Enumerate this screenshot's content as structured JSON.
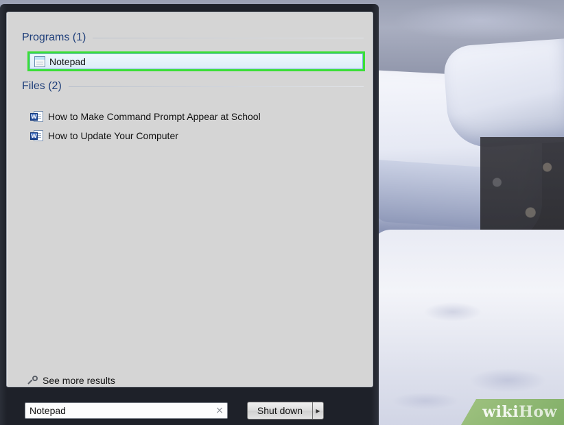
{
  "results": {
    "programs_header": "Programs (1)",
    "programs": [
      {
        "label": "Notepad",
        "icon": "notepad-icon"
      }
    ],
    "files_header": "Files (2)",
    "files": [
      {
        "label": "How to Make Command Prompt Appear at School",
        "icon": "word-document-icon"
      },
      {
        "label": "How to Update Your Computer",
        "icon": "word-document-icon"
      }
    ],
    "see_more": "See more results",
    "selection_outline_color": "#3adf36"
  },
  "search": {
    "value": "Notepad",
    "clear_glyph": "×"
  },
  "power": {
    "shutdown_label": "Shut down",
    "arrow_glyph": "▶"
  },
  "watermark": {
    "wiki": "wiki",
    "how": "How"
  },
  "word_badge": "W"
}
